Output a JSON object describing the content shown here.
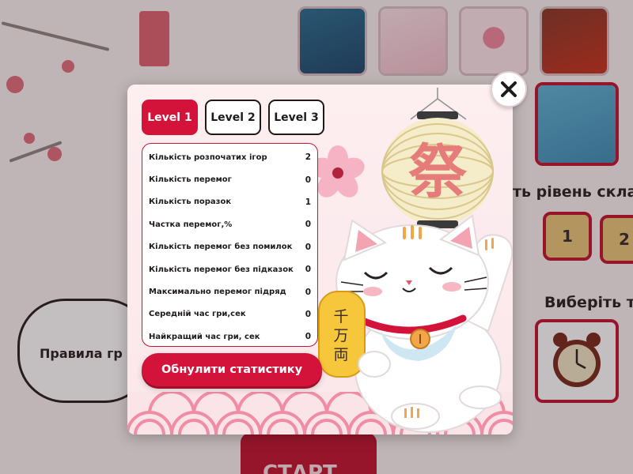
{
  "background": {
    "level_select_title": "ть рівень скла",
    "level_buttons": [
      "1",
      "2"
    ],
    "choose_title": "Виберіть т",
    "rules_label": "Правила гр",
    "start_label": "СТАРТ",
    "thumbnail_icons": [
      "ocean-thumbnail-icon",
      "princess-thumbnail-icon",
      "hearts-thumbnail-icon",
      "cars-thumbnail-icon",
      "paw-patrol-thumbnail-icon",
      "clock-card-icon"
    ]
  },
  "modal": {
    "tabs": [
      {
        "label": "Level 1",
        "active": true
      },
      {
        "label": "Level 2",
        "active": false
      },
      {
        "label": "Level 3",
        "active": false
      }
    ],
    "stats": [
      {
        "label": "Кількість розпочатих ігор",
        "value": "2"
      },
      {
        "label": "Кількість перемог",
        "value": "0"
      },
      {
        "label": "Кількість поразок",
        "value": "1"
      },
      {
        "label": "Частка перемог,%",
        "value": "0"
      },
      {
        "label": "Кількість перемог без помилок",
        "value": "0"
      },
      {
        "label": "Кількість перемог без підказок",
        "value": "0"
      },
      {
        "label": "Максимально перемог підряд",
        "value": "0"
      },
      {
        "label": "Середній час гри,сек",
        "value": "0"
      },
      {
        "label": "Найкращий час гри, сек",
        "value": "0"
      }
    ],
    "reset_label": "Обнулити статистику",
    "close_icon": "close-icon",
    "art": {
      "lantern_glyph": "祭",
      "coin_glyph": "千万両"
    }
  },
  "colors": {
    "accent": "#d3133a",
    "dark_accent": "#c21633",
    "text": "#1f1a1a"
  }
}
